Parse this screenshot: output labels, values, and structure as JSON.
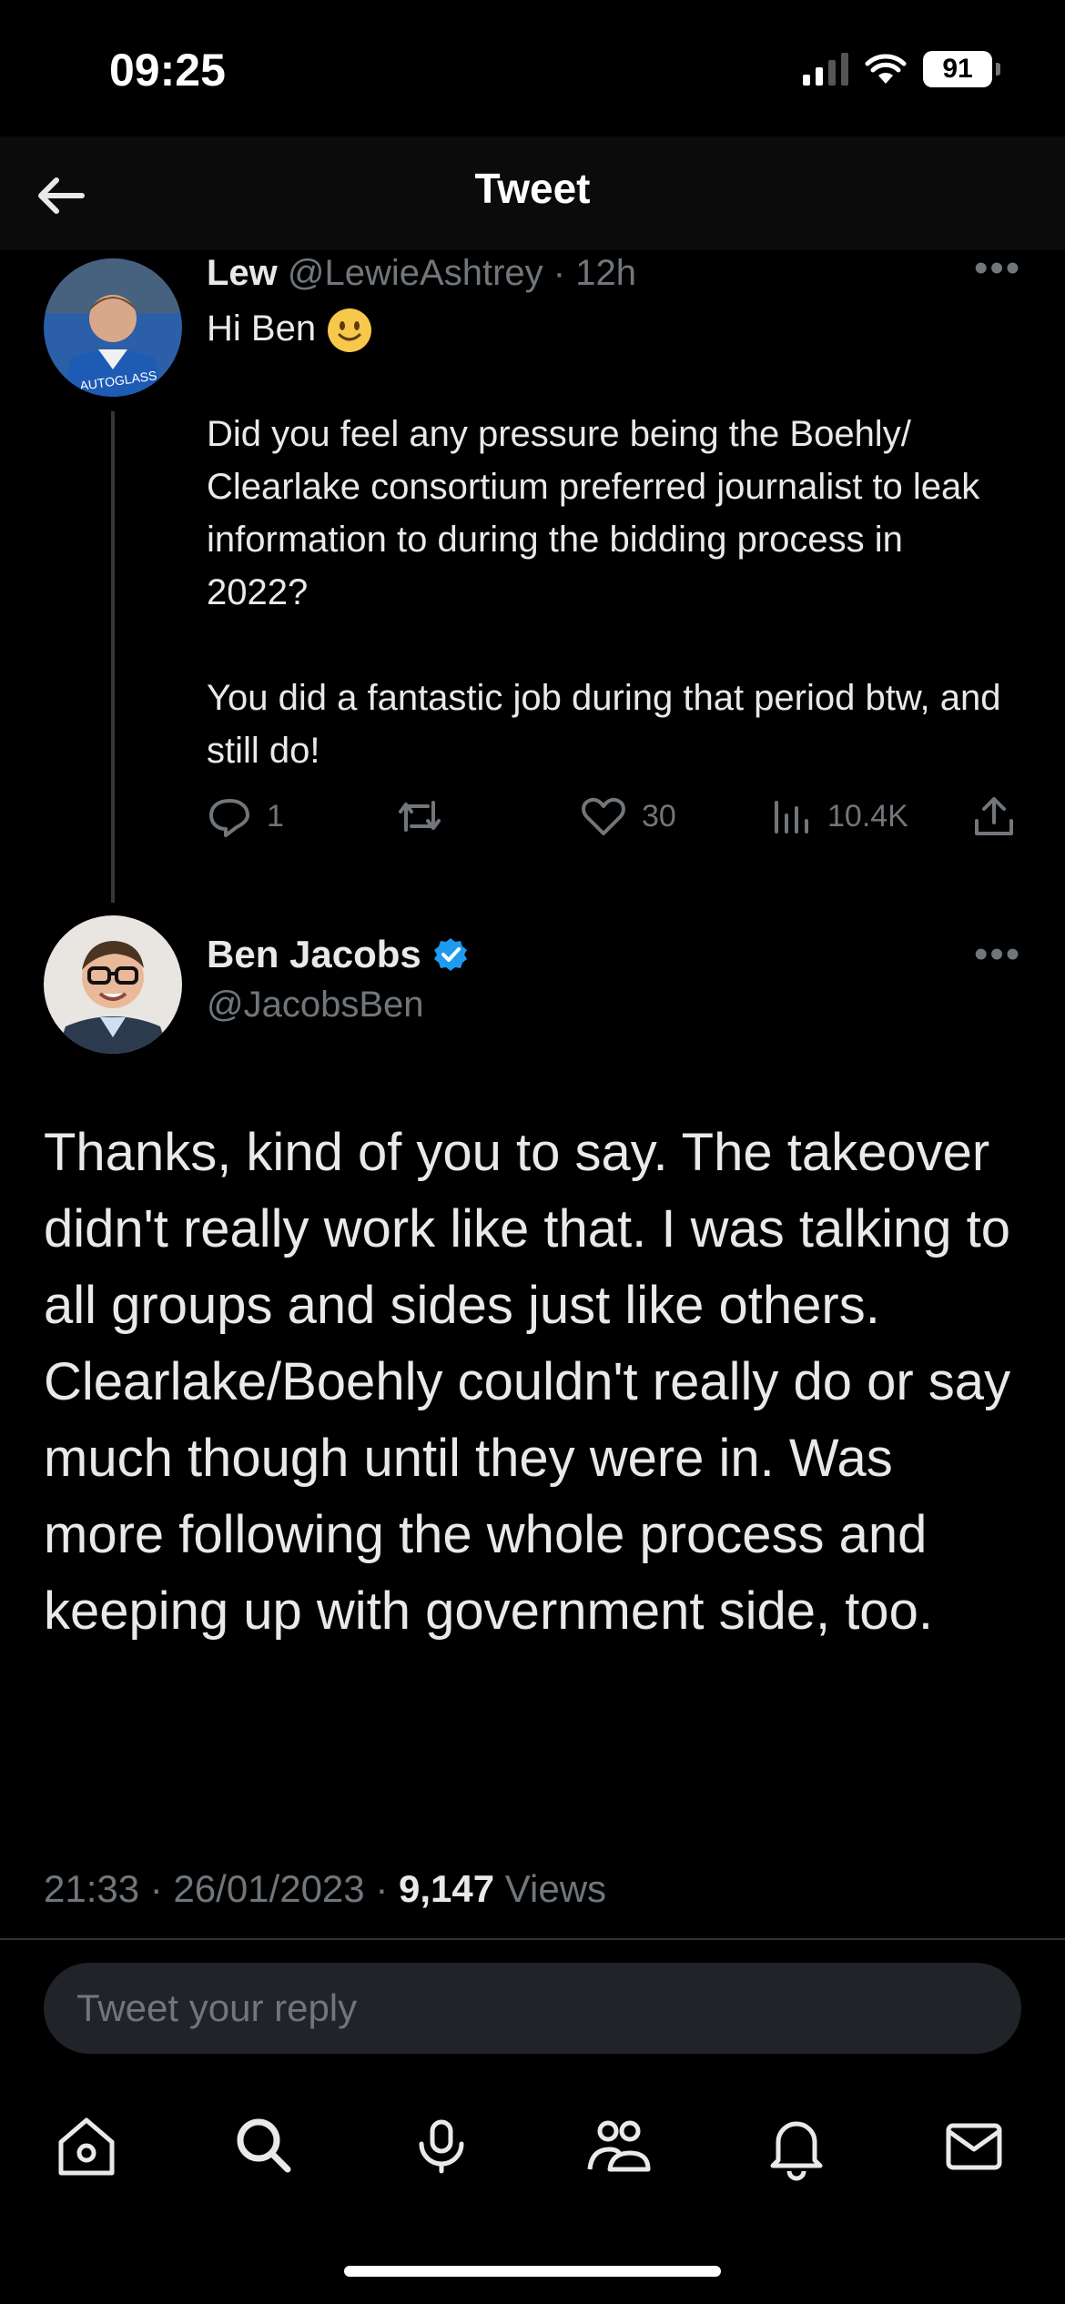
{
  "status_bar": {
    "time": "09:25",
    "battery": "91"
  },
  "header": {
    "title": "Tweet"
  },
  "parent_tweet": {
    "name": "Lew",
    "handle": "@LewieAshtrey",
    "separator": "·",
    "age": "12h",
    "greeting": "Hi Ben",
    "paragraphs": [
      "Did you feel any pressure being the Boehly/ Clearlake consortium preferred journalist to leak information to during the bidding process in 2022?",
      "You did a fantastic job during that period btw, and still do!"
    ],
    "replies": "1",
    "likes": "30",
    "views": "10.4K",
    "avatar_text": "AUTOGLASS"
  },
  "main_tweet": {
    "name": "Ben Jacobs",
    "handle": "@JacobsBen",
    "text": "Thanks, kind of you to say. The takeover didn't really work like that. I was talking to all groups and sides just like others. Clearlake/Boehly couldn't really do or say much though until they were in. Was more following the whole process and keeping up with government side, too.",
    "time": "21:33",
    "date": "26/01/2023",
    "views_count": "9,147",
    "views_label": "Views"
  },
  "reply_box": {
    "placeholder": "Tweet your reply"
  },
  "colors": {
    "background": "#000000",
    "text": "#e7e9ea",
    "muted": "#71767b",
    "verified": "#1d9bf0"
  },
  "icons": [
    "back-arrow-icon",
    "more-icon",
    "reply-icon",
    "retweet-icon",
    "like-icon",
    "views-icon",
    "share-icon",
    "verified-badge-icon",
    "home-icon",
    "search-icon",
    "spaces-icon",
    "communities-icon",
    "notifications-icon",
    "messages-icon"
  ]
}
